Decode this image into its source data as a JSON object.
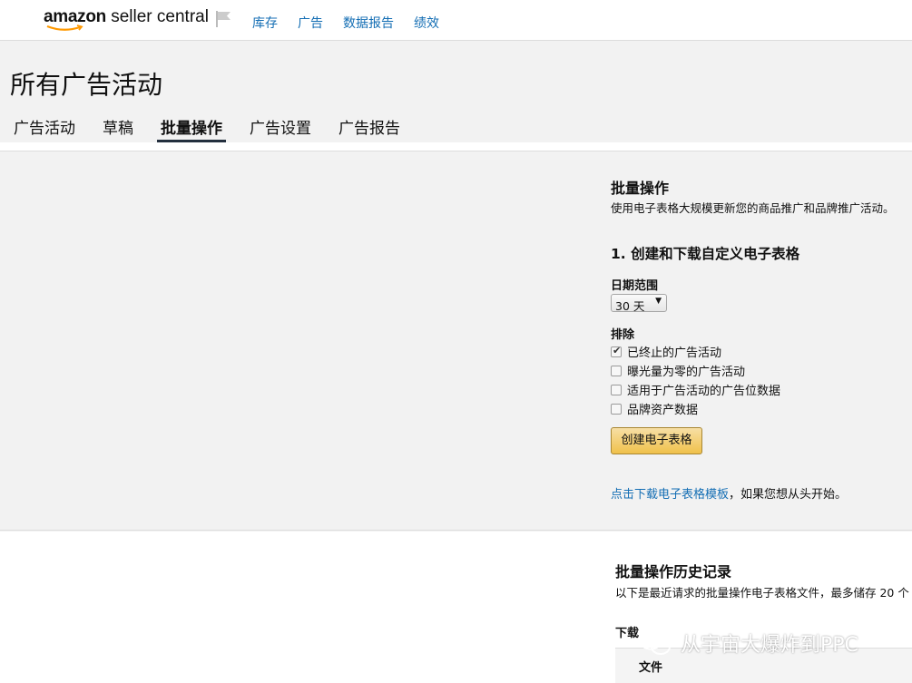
{
  "header": {
    "logo_bold": "amazon",
    "logo_rest": " seller central",
    "nav": [
      "库存",
      "广告",
      "数据报告",
      "绩效"
    ]
  },
  "page": {
    "title": "所有广告活动",
    "tabs": [
      "广告活动",
      "草稿",
      "批量操作",
      "广告设置",
      "广告报告"
    ],
    "active_tab": "批量操作"
  },
  "bulk": {
    "title": "批量操作",
    "description": "使用电子表格大规模更新您的商品推广和品牌推广活动。",
    "step1_title": "1. 创建和下载自定义电子表格",
    "date_range_label": "日期范围",
    "date_range_value": "30 天",
    "exclude_label": "排除",
    "exclude_options": [
      {
        "label": "已终止的广告活动",
        "checked": true
      },
      {
        "label": "曝光量为零的广告活动",
        "checked": false
      },
      {
        "label": "适用于广告活动的广告位数据",
        "checked": false
      },
      {
        "label": "品牌资产数据",
        "checked": false
      }
    ],
    "create_button": "创建电子表格",
    "template_link": "点击下载电子表格模板",
    "template_suffix": "，如果您想从头开始。"
  },
  "history": {
    "title": "批量操作历史记录",
    "description": "以下是最近请求的批量操作电子表格文件，最多储存 20 个",
    "download_label": "下载",
    "column_file": "文件"
  },
  "watermark": {
    "text": "从宇宙大爆炸到PPC",
    "icon": "wechat-icon"
  },
  "colors": {
    "link": "#146eb4",
    "button": "#f0c14b",
    "tab_underline": "#232f3e"
  }
}
